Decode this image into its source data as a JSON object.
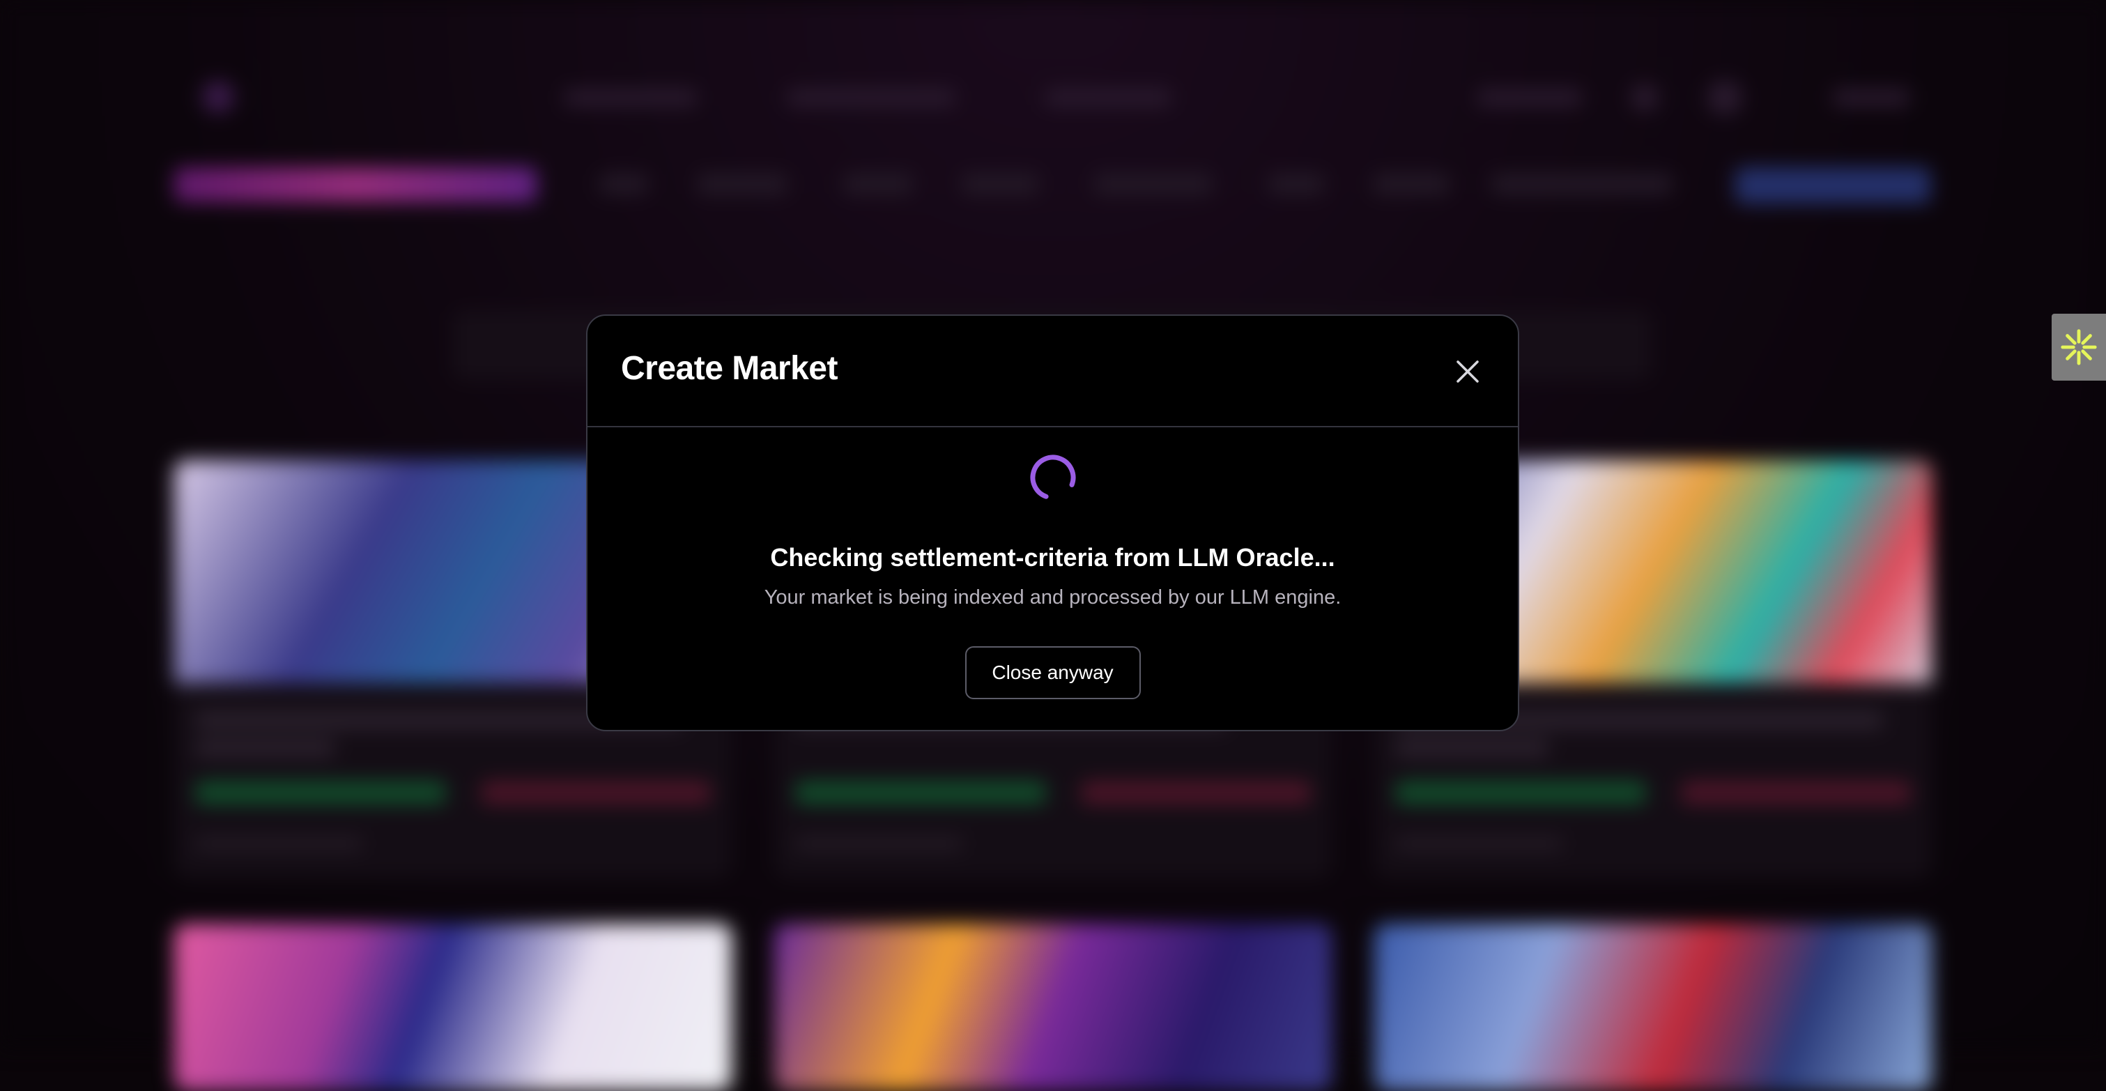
{
  "modal": {
    "title": "Create Market",
    "status_title": "Checking settlement-criteria from LLM Oracle...",
    "status_subtitle": "Your market is being indexed and processed by our LLM engine.",
    "close_anyway_label": "Close anyway",
    "spinner_color": "#9b5de5"
  },
  "side_widget": {
    "icon": "asterisk-burst-icon",
    "color": "#e5f55a"
  },
  "icons": {
    "close": "close-icon",
    "spinner": "loading-spinner-icon"
  }
}
